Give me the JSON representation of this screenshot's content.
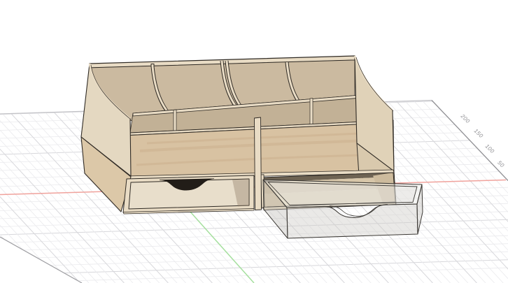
{
  "viewport": {
    "kind": "3d-cad-viewport",
    "background_color": "#ffffff",
    "grid": {
      "minor_color": "#eaeaed",
      "major_color": "#d7d7db",
      "far_edge_color": "#c2c2c6",
      "right_edge_color": "#8f8f93",
      "left_edge_color": "#9e9ea2",
      "tick_label_color": "#8e8e92",
      "tick_labels": [
        {
          "text": "200"
        },
        {
          "text": "150"
        },
        {
          "text": "100"
        },
        {
          "text": "50"
        }
      ]
    },
    "axes": {
      "x_axis_color": "#f0a29c",
      "y_axis_color": "#a5df9e"
    },
    "model": {
      "name": "plywood desk organizer with two drawers (right drawer pulled out, shown transparent)",
      "colors": {
        "outline": "#2f2a24",
        "edge": "#e9dcc5",
        "face": "#d8c2a2",
        "grain": "rgba(173,136,92,0.16)",
        "leftUpper": "#e4d8c1",
        "leftLower": "#dcc8a8",
        "rightUpper": "#e0d2b8",
        "rightLower": "#d9c9ad",
        "intBack": "#cbbaa0",
        "intFront": "#c2b196",
        "drawerFront": "#e8decb",
        "drawerShade": "rgba(140,122,96,0.38)",
        "notch": "#221d18",
        "bayCeil": "#6e6353",
        "bayBack": "#d7c6a9",
        "bayFloor": "#e1d2b5",
        "bayRight": "#cdbb9d",
        "ghostTop": "rgba(236,235,231,0.5)",
        "ghostRim": "rgba(215,213,208,0.25)",
        "ghostLeft": "rgba(180,178,173,0.35)",
        "ghostFront": "rgba(210,208,202,0.46)",
        "ghostRight": "rgba(193,191,186,0.4)",
        "ghostEdge": "#3c3935"
      }
    }
  }
}
